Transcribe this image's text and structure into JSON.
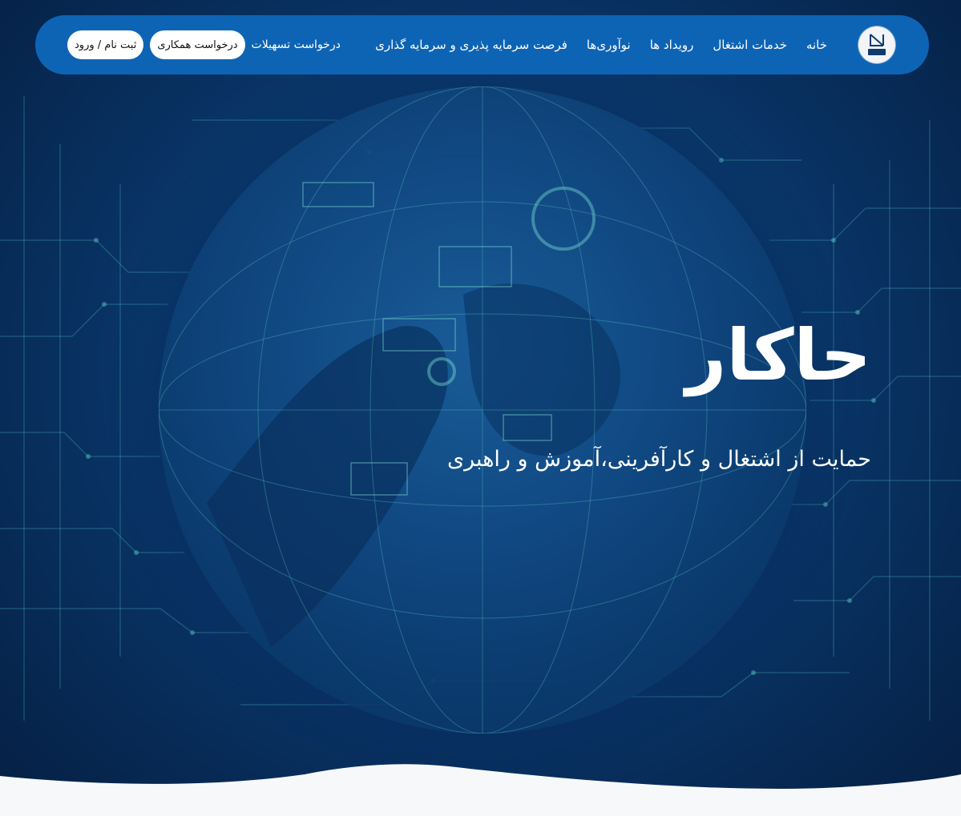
{
  "brand": {
    "logo_text": "حاکار",
    "logo_icon": "hakar-logo-icon"
  },
  "nav": {
    "items": [
      {
        "label": "خانه"
      },
      {
        "label": "خدمات اشتغال"
      },
      {
        "label": "رویداد ها"
      },
      {
        "label": "نوآوری‌ها"
      },
      {
        "label": "فرصت سرمایه پذیری و سرمایه گذاری"
      }
    ],
    "loan_request": "درخواست تسهیلات",
    "cooperation_request": "درخواست همکاری",
    "signup_login": "ثبت نام / ورود"
  },
  "hero": {
    "title": "حاکار",
    "subtitle": "حمایت از اشتغال و کارآفرینی،آموزش و راهبری",
    "background_icon": "digital-globe-image"
  },
  "colors": {
    "navbar": "#0e64b4",
    "background_dark": "#051f43",
    "background_mid": "#0a3a6f",
    "globe": "#124b85",
    "accent_lines": "#5fd0c8",
    "text": "#ffffff",
    "pill_bg": "#ffffff",
    "wave": "#f7f8fa"
  }
}
